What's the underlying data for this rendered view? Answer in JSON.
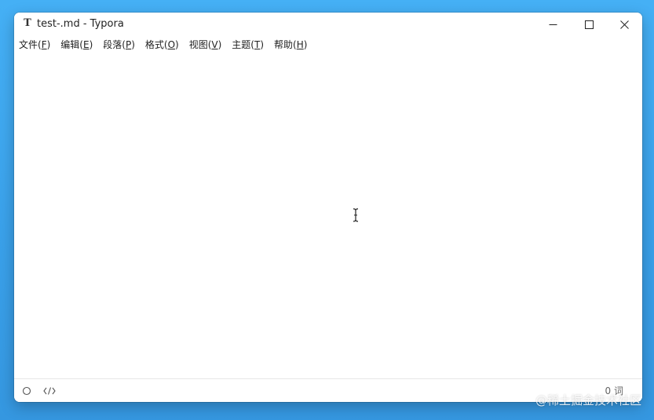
{
  "window": {
    "title": "test-.md - Typora",
    "app_icon_glyph": "T"
  },
  "menubar": {
    "items": [
      {
        "label": "文件(",
        "key": "F",
        "close": ")"
      },
      {
        "label": "编辑(",
        "key": "E",
        "close": ")"
      },
      {
        "label": "段落(",
        "key": "P",
        "close": ")"
      },
      {
        "label": "格式(",
        "key": "O",
        "close": ")"
      },
      {
        "label": "视图(",
        "key": "V",
        "close": ")"
      },
      {
        "label": "主题(",
        "key": "T",
        "close": ")"
      },
      {
        "label": "帮助(",
        "key": "H",
        "close": ")"
      }
    ]
  },
  "statusbar": {
    "word_count": "0 词"
  },
  "watermark": {
    "text": "@稀土掘金技术社区"
  },
  "icons": {
    "minimize": "minimize-icon",
    "maximize": "maximize-icon",
    "close": "close-icon",
    "outline": "circle-outline-icon",
    "source": "code-brackets-icon",
    "cursor": "text-cursor-icon"
  },
  "colors": {
    "desktop": "#3aa1ea",
    "window_bg": "#ffffff",
    "text": "#222222"
  }
}
